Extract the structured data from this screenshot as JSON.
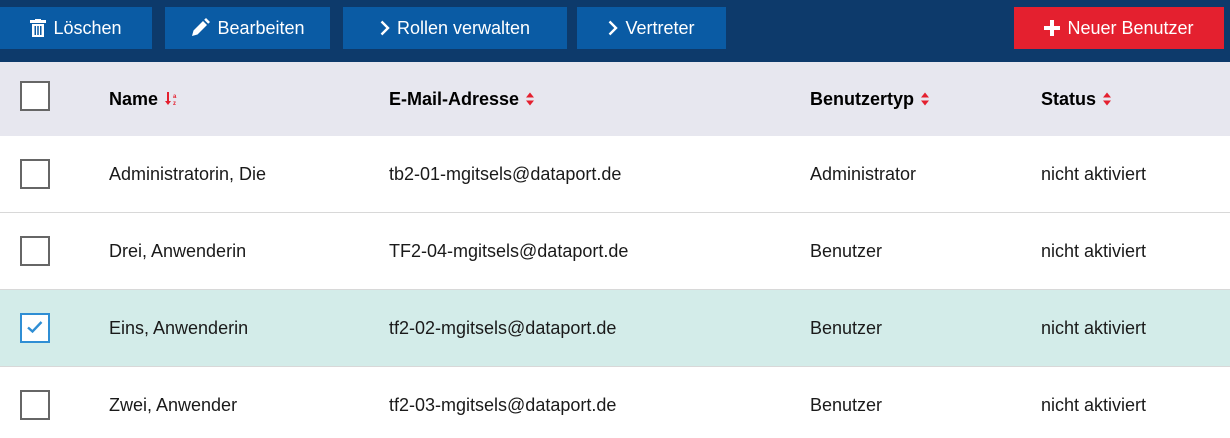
{
  "colors": {
    "toolbar_bg": "#0d3a6b",
    "button_blue": "#0a5ba4",
    "button_red": "#e4202f",
    "header_bg": "#e7e7ef",
    "selected_row_bg": "#d3ece9",
    "sort_icon": "#e4202f",
    "checkbox_checked": "#2f8ed4"
  },
  "toolbar": {
    "delete": {
      "label": "Löschen",
      "icon": "trash-icon"
    },
    "edit": {
      "label": "Bearbeiten",
      "icon": "pencil-icon"
    },
    "roles": {
      "label": "Rollen verwalten",
      "icon": "chevron-right-icon"
    },
    "deputy": {
      "label": "Vertreter",
      "icon": "chevron-right-icon"
    },
    "new_user": {
      "label": "Neuer Benutzer",
      "icon": "plus-icon"
    }
  },
  "table": {
    "columns": [
      {
        "label": "Name",
        "sort": "alpha-sort-asc-icon"
      },
      {
        "label": "E-Mail-Adresse",
        "sort": "sort-updown-icon"
      },
      {
        "label": "Benutzertyp",
        "sort": "sort-updown-icon"
      },
      {
        "label": "Status",
        "sort": "sort-updown-icon"
      }
    ],
    "rows": [
      {
        "name": "Administratorin, Die",
        "email": "tb2-01-mgitsels@dataport.de",
        "type": "Administrator",
        "status": "nicht aktiviert",
        "selected": false
      },
      {
        "name": "Drei, Anwenderin",
        "email": "TF2-04-mgitsels@dataport.de",
        "type": "Benutzer",
        "status": "nicht aktiviert",
        "selected": false
      },
      {
        "name": "Eins, Anwenderin",
        "email": "tf2-02-mgitsels@dataport.de",
        "type": "Benutzer",
        "status": "nicht aktiviert",
        "selected": true
      },
      {
        "name": "Zwei, Anwender",
        "email": "tf2-03-mgitsels@dataport.de",
        "type": "Benutzer",
        "status": "nicht aktiviert",
        "selected": false
      }
    ]
  }
}
